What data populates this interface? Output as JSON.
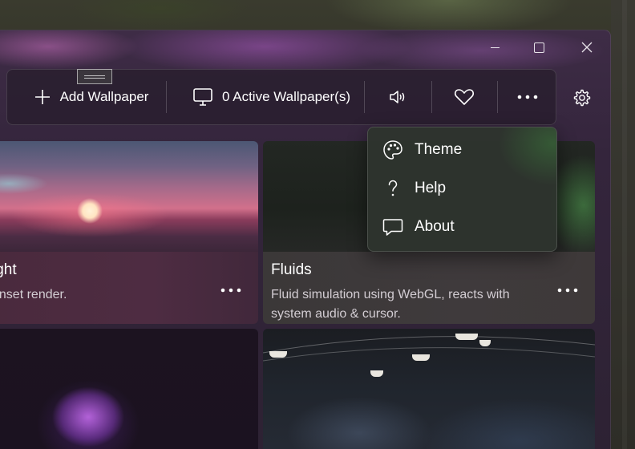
{
  "command_bar": {
    "add_label": "Add Wallpaper",
    "active_label": "0 Active Wallpaper(s)"
  },
  "icons": {
    "add": "plus-icon",
    "active": "monitor-icon",
    "audio": "speaker-icon",
    "favorite": "heart-icon",
    "more": "more-dots-icon",
    "settings": "gear-icon",
    "theme": "palette-icon",
    "help": "question-icon",
    "about": "chat-bubble-icon"
  },
  "menu": {
    "items": [
      {
        "label": "Theme"
      },
      {
        "label": "Help"
      },
      {
        "label": "About"
      }
    ]
  },
  "cards": [
    {
      "title": "ight",
      "description": "unset render."
    },
    {
      "title": "Fluids",
      "description": "Fluid simulation using WebGL, reacts with system audio & cursor."
    }
  ],
  "colors": {
    "window_tint": "#3e2c46",
    "flyout_bg": "#2e342e",
    "text": "#ffffff",
    "secondary_text": "#d3cdd3"
  }
}
